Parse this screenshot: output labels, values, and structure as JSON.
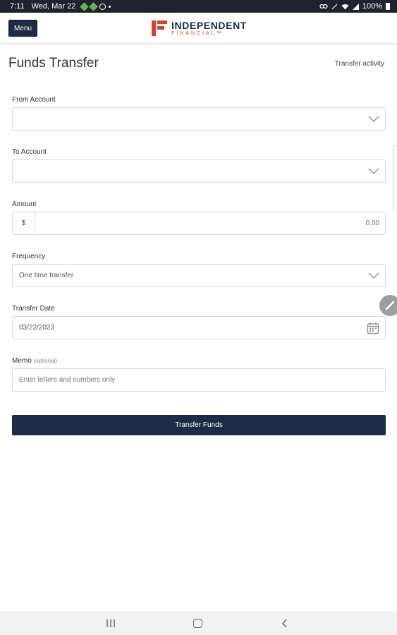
{
  "status_bar": {
    "time": "7:11",
    "date": "Wed, Mar 22",
    "battery": "100%",
    "icons": [
      "android-icon",
      "android-icon",
      "sync-icon",
      "dot-icon",
      "link-icon",
      "mute-icon",
      "wifi-icon",
      "signal-icon",
      "battery-icon"
    ]
  },
  "header": {
    "menu_label": "Menu",
    "logo": {
      "main": "INDEPENDENT",
      "sub": "FINANCIAL™",
      "accent_color": "#d5442a",
      "brand_color": "#1e2b47"
    }
  },
  "page": {
    "title": "Funds Transfer",
    "activity_link": "Transfer activity"
  },
  "form": {
    "from_account": {
      "label": "From Account",
      "value": ""
    },
    "to_account": {
      "label": "To Account",
      "value": ""
    },
    "amount": {
      "label": "Amount",
      "currency": "$",
      "placeholder": "0.00"
    },
    "frequency": {
      "label": "Frequency",
      "value": "One time transfer"
    },
    "transfer_date": {
      "label": "Transfer Date",
      "value": "03/22/2023"
    },
    "memo": {
      "label": "Memo",
      "optional": "(optional)",
      "placeholder": "Enter letters and numbers only"
    },
    "submit_label": "Transfer Funds"
  },
  "nav_bar": {
    "buttons": [
      "recents-icon",
      "home-icon",
      "back-icon"
    ]
  }
}
